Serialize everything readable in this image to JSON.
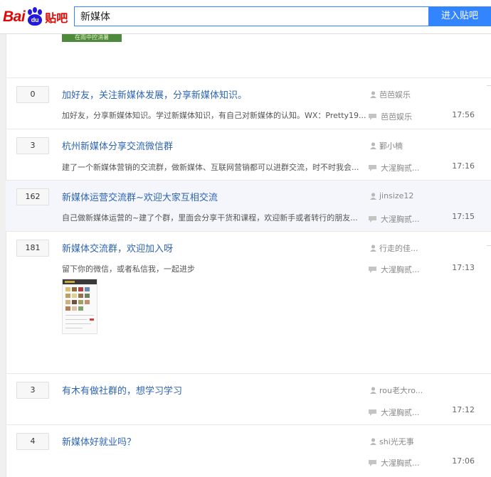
{
  "logo": {
    "part1": "Bai",
    "paw_text": "du",
    "part2": "贴吧"
  },
  "search": {
    "value": "新媒体",
    "button": "进入贴吧"
  },
  "top_thumb_text": "在雨中控消暑",
  "threads": [
    {
      "replies": "0",
      "title": "加好友，关注新媒体发展，分享新媒体知识。",
      "desc": "加好友，分享新媒体知识。学过新媒体知识，有自己对新媒体的认知。WX：Pretty19...",
      "author": "芭芭娱乐",
      "last_replier": "芭芭娱乐",
      "time": "17:56"
    },
    {
      "replies": "3",
      "title": "杭州新媒体分享交流微信群",
      "desc": "建了一个新媒体营销的交流群，做新媒体、互联网营销都可以进群交流，时不时我会...",
      "author": "鄞小楠",
      "last_replier": "大湦胸贰...",
      "time": "17:16"
    },
    {
      "replies": "162",
      "title": "新媒体运营交流群~欢迎大家互相交流",
      "desc": "自己做新媒体运营的~建了个群，里面会分享干货和课程，欢迎新手或者转行的朋友...",
      "author": "jinsize12",
      "last_replier": "大湦胸贰...",
      "time": "17:15",
      "highlighted": true
    },
    {
      "replies": "181",
      "title": "新媒体交流群，欢迎加入呀",
      "desc": "留下你的微信，或者私信我，一起进步",
      "author": "行走的佳...",
      "last_replier": "大湦胸贰...",
      "time": "17:13"
    },
    {
      "replies": "3",
      "title": "有木有做社群的，想学习学习",
      "desc": "",
      "author": "rou老大ro...",
      "last_replier": "大湦胸贰...",
      "time": "17:12"
    },
    {
      "replies": "4",
      "title": "新媒体好就业吗？",
      "desc": "",
      "author": "shi光无事",
      "last_replier": "大湦胸贰...",
      "time": "17:06"
    }
  ],
  "colors": {
    "accent": "#3385ff",
    "link": "#2d64b3",
    "logo_red": "#e10601",
    "logo_blue": "#2319dc",
    "highlight_row": "#f4f6fb"
  },
  "icons": [
    "author-icon",
    "reply-icon",
    "baidu-paw-logo"
  ]
}
